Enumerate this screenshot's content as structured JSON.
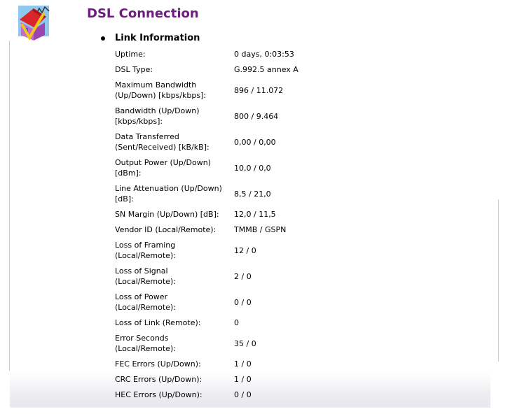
{
  "page": {
    "title": "DSL Connection",
    "section_title": "Link Information"
  },
  "link_info": [
    {
      "label": "Uptime:",
      "value": "0 days, 0:03:53"
    },
    {
      "label": "DSL Type:",
      "value": "G.992.5 annex A"
    },
    {
      "label": "Maximum Bandwidth\n(Up/Down) [kbps/kbps]:",
      "value": "896 / 11.072"
    },
    {
      "label": "Bandwidth (Up/Down)\n[kbps/kbps]:",
      "value": "800 / 9.464"
    },
    {
      "label": "Data Transferred\n(Sent/Received) [kB/kB]:",
      "value": "0,00 / 0,00"
    },
    {
      "label": "Output Power (Up/Down)\n[dBm]:",
      "value": "10,0 / 0,0"
    },
    {
      "label": "Line Attenuation (Up/Down)\n[dB]:",
      "value": "8,5 / 21,0"
    },
    {
      "label": "SN Margin (Up/Down) [dB]:",
      "value": "12,0 / 11,5"
    },
    {
      "label": "Vendor ID (Local/Remote):",
      "value": "TMMB / GSPN"
    },
    {
      "label": "Loss of Framing\n(Local/Remote):",
      "value": "12 / 0"
    },
    {
      "label": "Loss of Signal\n(Local/Remote):",
      "value": "2 / 0"
    },
    {
      "label": "Loss of Power\n(Local/Remote):",
      "value": "0 / 0"
    },
    {
      "label": "Loss of Link (Remote):",
      "value": "0"
    },
    {
      "label": "Error Seconds\n(Local/Remote):",
      "value": "35 / 0"
    },
    {
      "label": "FEC Errors (Up/Down):",
      "value": "1 / 0"
    },
    {
      "label": "CRC Errors (Up/Down):",
      "value": "1 / 0"
    },
    {
      "label": "HEC Errors (Up/Down):",
      "value": "0 / 0"
    }
  ],
  "icons": {
    "logo": "house-connection-icon"
  }
}
